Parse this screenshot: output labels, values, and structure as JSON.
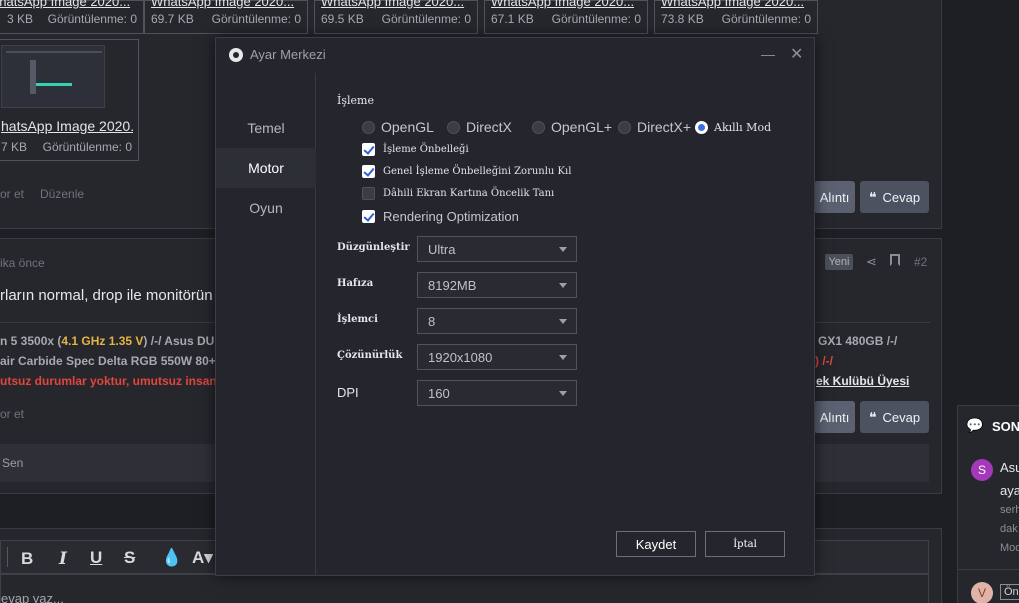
{
  "attachments_top": [
    {
      "title": "WhatsApp Image 2020...",
      "size": "3 KB",
      "views": "Görüntülenme: 0"
    },
    {
      "title": "WhatsApp Image 2020...",
      "size": "69.7 KB",
      "views": "Görüntülenme: 0"
    },
    {
      "title": "WhatsApp Image 2020...",
      "size": "69.5 KB",
      "views": "Görüntülenme: 0"
    },
    {
      "title": "WhatsApp Image 2020...",
      "size": "67.1 KB",
      "views": "Görüntülenme: 0"
    },
    {
      "title": "WhatsApp Image 2020...",
      "size": "73.8 KB",
      "views": "Görüntülenme: 0"
    }
  ],
  "attachment_big": {
    "title": "hatsApp Image 2020...",
    "size": "7 KB",
    "views": "Görüntülenme: 0"
  },
  "post1": {
    "report": "or et",
    "edit": "Düzenle",
    "quote": "Alıntı",
    "reply": "Cevap"
  },
  "post2": {
    "time": "ika önce",
    "badge": "Yeni",
    "number": "#2",
    "text": "rların normal, drop ile monitörün",
    "sig_line1_a": "n 5 3500x (",
    "sig_line1_b": "4.1 GHz 1.35 V",
    "sig_line1_c": ") /-/ Asus DU",
    "sig_line1_right": "GX1 480GB /-/",
    "sig_line2": "air Carbide Spec Delta RGB 550W 80+",
    "sig_line2_right": ") /-/",
    "sig_line3": "utsuz durumlar yoktur, umutsuz insan",
    "sig_line3_right": "ek Kulübü Üyesi",
    "report": "or et",
    "quote": "Alıntı",
    "reply": "Cevap",
    "reacted": "Sen"
  },
  "editor": {
    "placeholder": "evap yaz..."
  },
  "sidebar_right": {
    "heading": "SON",
    "item1_initial": "S",
    "item1_title": "Asu",
    "item1_title2": "aya",
    "item1_meta1": "serh",
    "item1_meta2": "dak",
    "item1_meta3": "Mod",
    "item2_initial": "V",
    "item2_tag": "Ön"
  },
  "modal": {
    "title": "Ayar Merkezi",
    "nav": [
      "Temel",
      "Motor",
      "Oyun"
    ],
    "active_nav": "Motor",
    "rendering_label": "İşleme",
    "render_modes": [
      {
        "label": "OpenGL",
        "selected": false
      },
      {
        "label": "DirectX",
        "selected": false
      },
      {
        "label": "OpenGL+",
        "selected": false
      },
      {
        "label": "DirectX+",
        "selected": false
      },
      {
        "label": "Akıllı Mod",
        "selected": true
      }
    ],
    "checks": [
      {
        "label": "İşleme Önbelleği",
        "checked": true
      },
      {
        "label": "Genel İşleme Önbelleğini Zorunlu Kıl",
        "checked": true
      },
      {
        "label": "Dâhili Ekran Kartına Öncelik Tanı",
        "checked": false
      },
      {
        "label": "Rendering Optimization",
        "checked": true
      }
    ],
    "fields": [
      {
        "label": "Düzgünleştir",
        "value": "Ultra"
      },
      {
        "label": "Hafıza",
        "value": "8192MB"
      },
      {
        "label": "İşlemci",
        "value": "8"
      },
      {
        "label": "Çözünürlük",
        "value": "1920x1080"
      },
      {
        "label": "DPI",
        "value": "160"
      }
    ],
    "save": "Kaydet",
    "cancel": "İptal"
  },
  "colors": {
    "accent": "#3e6fe0",
    "modal_bg": "#25262d",
    "page_bg": "#1e1f24"
  }
}
